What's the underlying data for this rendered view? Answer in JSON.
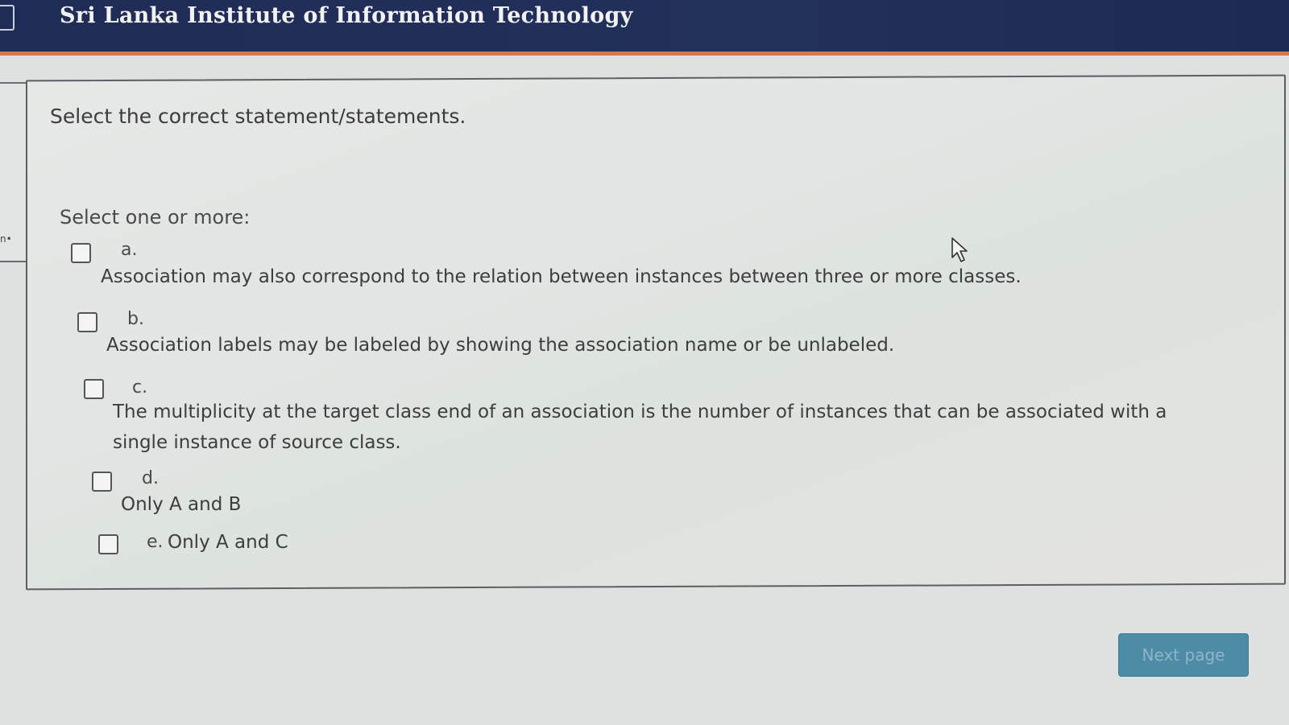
{
  "header": {
    "title": "Sri Lanka Institute of Information Technology"
  },
  "question": {
    "prompt": "Select the correct statement/statements.",
    "instruction": "Select one or more:",
    "options": [
      {
        "letter": "a.",
        "text": "Association may also correspond to the relation between instances between three or more classes."
      },
      {
        "letter": "b.",
        "text": "Association labels may be labeled by showing the association name or be unlabeled."
      },
      {
        "letter": "c.",
        "text": "The multiplicity at the target class end of an association is the number of instances that can be associated with a single instance of source class."
      },
      {
        "letter": "d.",
        "text": "Only A and B"
      },
      {
        "letter": "e.",
        "text": "Only A and C"
      }
    ]
  },
  "navigation": {
    "next_label": "Next page"
  },
  "colors": {
    "header_bg": "#1f2c56",
    "header_accent": "#d9764e",
    "button_bg": "#4d8ba6"
  }
}
